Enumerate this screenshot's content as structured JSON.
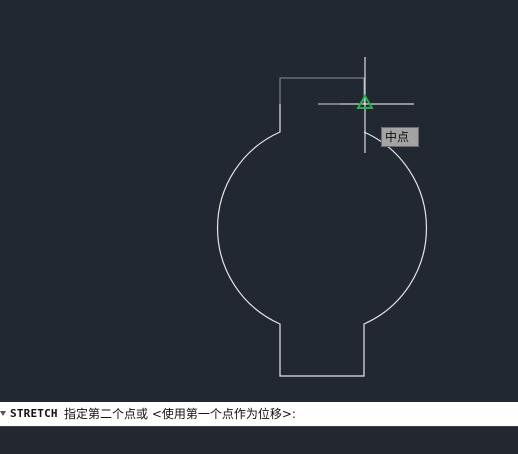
{
  "snap_tooltip": {
    "text": "中点"
  },
  "command_line": {
    "command": "STRETCH",
    "prompt": "指定第二个点或 <使用第一个点作为位移>:"
  },
  "colors": {
    "background": "#222831",
    "geometry": "#e6e6e6",
    "preview": "#8a8f96",
    "crosshair": "#ffffff",
    "snap_marker": "#22b14c"
  },
  "icons": {
    "snap_marker": "midpoint-triangle-icon",
    "command_arrow": "caret-down-icon"
  }
}
